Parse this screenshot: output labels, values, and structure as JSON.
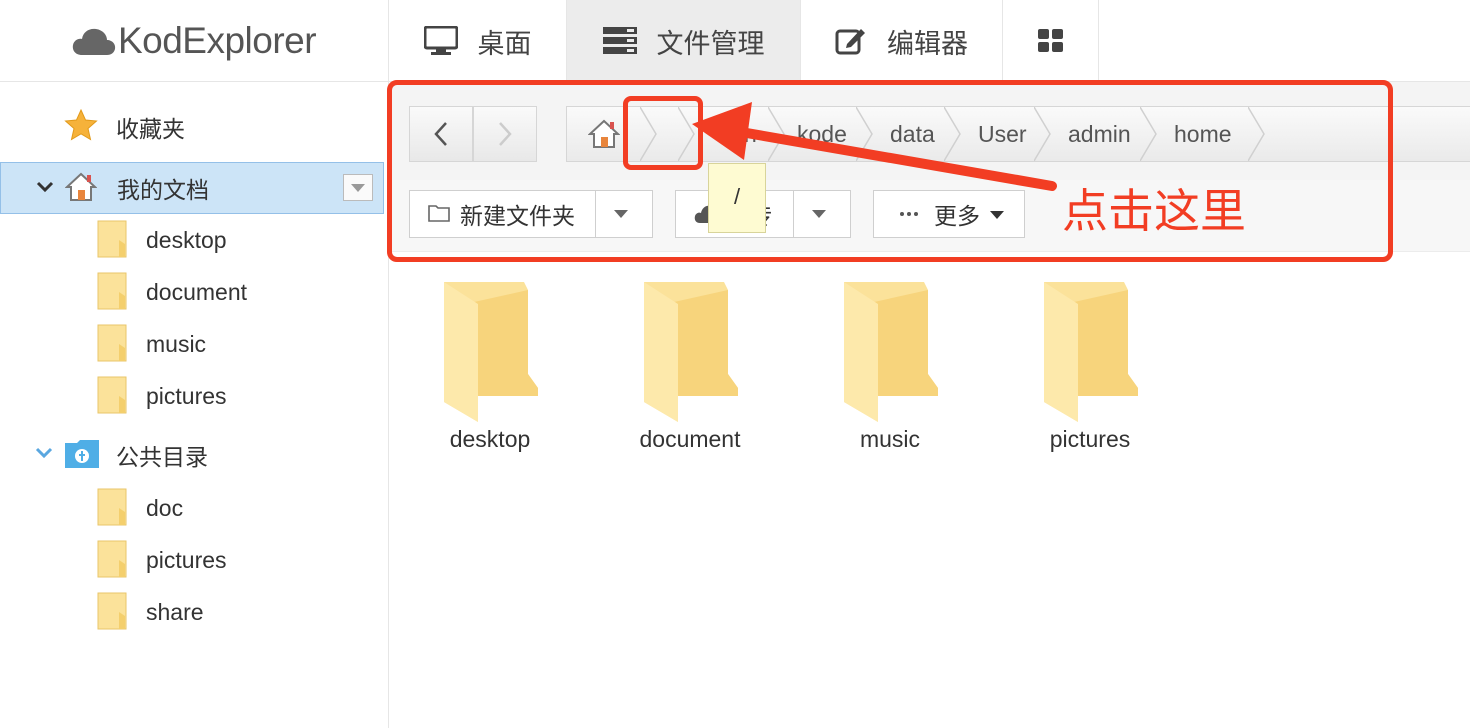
{
  "app": {
    "logo_text": "KodExplorer"
  },
  "nav": {
    "desktop": "桌面",
    "files": "文件管理",
    "editor": "编辑器"
  },
  "sidebar": {
    "favorites": "收藏夹",
    "my_docs": "我的文档",
    "my_docs_children": [
      "desktop",
      "document",
      "music",
      "pictures"
    ],
    "public": "公共目录",
    "public_children": [
      "doc",
      "pictures",
      "share"
    ]
  },
  "breadcrumb": {
    "tooltip": "/",
    "segments": [
      "h",
      "kode",
      "data",
      "User",
      "admin",
      "home"
    ]
  },
  "toolbar": {
    "new_folder": "新建文件夹",
    "upload": "上传",
    "more": "更多"
  },
  "annotation": {
    "text": "点击这里",
    "color": "#f23d23"
  },
  "files": [
    "desktop",
    "document",
    "music",
    "pictures"
  ]
}
